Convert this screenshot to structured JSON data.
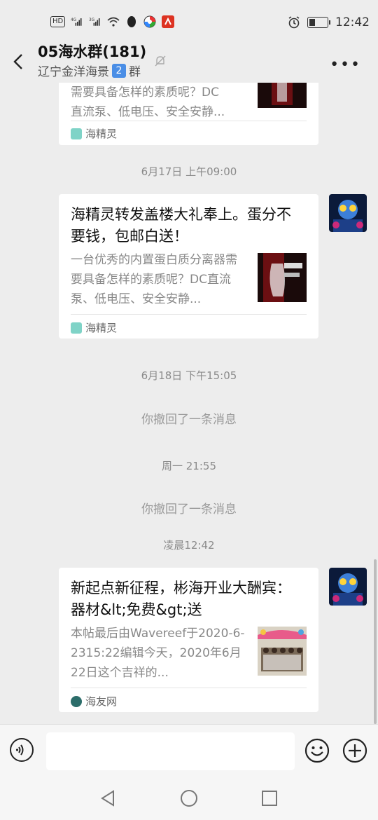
{
  "status_bar": {
    "left_labels": [
      "HD",
      "4G",
      "3G"
    ],
    "time": "12:42"
  },
  "header": {
    "title": "05海水群(181)",
    "subtitle_prefix": "辽宁金洋海景",
    "subtitle_badge": "2",
    "subtitle_suffix": "群"
  },
  "messages": {
    "card0": {
      "desc": "需要具备怎样的素质呢？DC\n直流泵、低电压、安全安静...",
      "source": "海精灵"
    },
    "time1": "6月17日 上午09:00",
    "card1": {
      "title": "海精灵转发盖楼大礼奉上。蛋分不要钱，包邮白送！",
      "desc": "一台优秀的内置蛋白质分离器需要具备怎样的素质呢？DC直流泵、低电压、安全安静...",
      "source": "海精灵"
    },
    "time2": "6月18日 下午15:05",
    "sys1": "你撤回了一条消息",
    "time3": "周一 21:55",
    "sys2": "你撤回了一条消息",
    "time4": "凌晨12:42",
    "card2": {
      "title": "新起点新征程，彬海开业大酬宾：器材&lt;免费&gt;送",
      "desc": "本帖最后由Wavereef于2020-6-2315:22编辑今天，2020年6月22日这个吉祥的...",
      "source": "海友网"
    }
  },
  "icons": {
    "back": "back-arrow-icon",
    "mute": "mute-bell-icon",
    "more": "more-icon",
    "voice": "voice-icon",
    "emoji": "emoji-icon",
    "plus": "plus-icon"
  }
}
